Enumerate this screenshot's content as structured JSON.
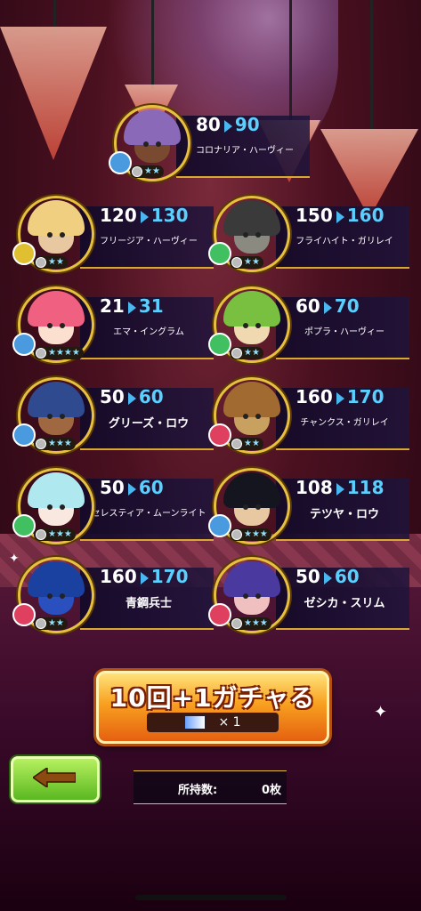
{
  "characters": [
    {
      "from": "80",
      "to": "90",
      "name": "コロナリア・ハーヴィー",
      "stars": "★★",
      "element_color": "#4a9ae0",
      "hair": "#8a6ab8",
      "skin": "#7a4a30"
    },
    {
      "from": "120",
      "to": "130",
      "name": "フリージア・ハーヴィー",
      "stars": "★★",
      "element_color": "#e0c030",
      "hair": "#f0d080",
      "skin": "#e8c8a0"
    },
    {
      "from": "150",
      "to": "160",
      "name": "フライハイト・ガリレイ",
      "stars": "★★",
      "element_color": "#40c060",
      "hair": "#3a3a3a",
      "skin": "#8a8a80"
    },
    {
      "from": "21",
      "to": "31",
      "name": "エマ・イングラム",
      "stars": "★★★★",
      "element_color": "#4a9ae0",
      "hair": "#f06080",
      "skin": "#fbe0d0"
    },
    {
      "from": "60",
      "to": "70",
      "name": "ポプラ・ハーヴィー",
      "stars": "★★",
      "element_color": "#40c060",
      "hair": "#7ac040",
      "skin": "#f0d8b0"
    },
    {
      "from": "50",
      "to": "60",
      "name": "グリーズ・ロウ",
      "stars": "★★★",
      "element_color": "#4a9ae0",
      "hair": "#304a90",
      "skin": "#a06840"
    },
    {
      "from": "160",
      "to": "170",
      "name": "チャンクス・ガリレイ",
      "stars": "★★",
      "element_color": "#e04060",
      "hair": "#a06a30",
      "skin": "#c8a060"
    },
    {
      "from": "50",
      "to": "60",
      "name": "セレスティア・ムーンライト",
      "stars": "★★★",
      "element_color": "#40c060",
      "hair": "#b0e8f0",
      "skin": "#f8e8e0"
    },
    {
      "from": "108",
      "to": "118",
      "name": "テツヤ・ロウ",
      "stars": "★★★",
      "element_color": "#4a9ae0",
      "hair": "#151520",
      "skin": "#e8c8a0"
    },
    {
      "from": "160",
      "to": "170",
      "name": "青鋼兵士",
      "stars": "★★",
      "element_color": "#e04060",
      "hair": "#1a40a0",
      "skin": "#2a50c0"
    },
    {
      "from": "50",
      "to": "60",
      "name": "ゼシカ・スリム",
      "stars": "★★★",
      "element_color": "#e04060",
      "hair": "#4a3aa0",
      "skin": "#f0c0c0"
    }
  ],
  "gacha": {
    "title": "10回+1ガチャる",
    "cost": "× 1",
    "ticket_icon": "ticket-icon"
  },
  "owned": {
    "label": "所持数:",
    "value": "0枚"
  },
  "back": {
    "icon": "back-arrow-icon",
    "color": "#8a4a10"
  },
  "accent_gold": "#e8c040",
  "accent_blue": "#5ad0ff"
}
